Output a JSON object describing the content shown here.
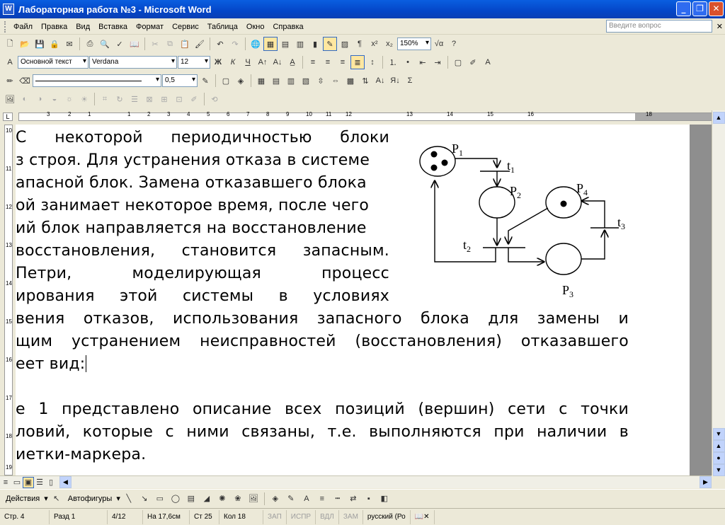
{
  "window": {
    "title": "Лабораторная работа №3 - Microsoft Word",
    "app_icon": "W"
  },
  "menu": {
    "items": [
      "Файл",
      "Правка",
      "Вид",
      "Вставка",
      "Формат",
      "Сервис",
      "Таблица",
      "Окно",
      "Справка"
    ],
    "ask_placeholder": "Введите вопрос"
  },
  "toolbar": {
    "zoom": "150%",
    "style": "Основной текст",
    "font": "Verdana",
    "size": "12",
    "line_weight": "0,5",
    "bold_label": "Ж",
    "italic_label": "К",
    "underline_label": "Ч"
  },
  "ruler": {
    "h_ticks": [
      "3",
      "2",
      "1",
      "1",
      "2",
      "3",
      "4",
      "5",
      "6",
      "7",
      "8",
      "9",
      "10",
      "11",
      "12",
      "13",
      "14",
      "15",
      "16",
      "18"
    ],
    "v_ticks": [
      "10",
      "11",
      "12",
      "13",
      "14",
      "15",
      "16",
      "17",
      "18",
      "19"
    ]
  },
  "document": {
    "lines": [
      [
        "С",
        "некоторой",
        "периодичностью",
        "блоки"
      ],
      [
        "з строя. Для устранения отказа в системе"
      ],
      [
        "апасной блок. Замена отказавшего блока"
      ],
      [
        "ой занимает некоторое время, после чего"
      ],
      [
        "ий блок направляется на восстановление"
      ],
      [
        "восстановления,",
        "становится",
        "запасным."
      ],
      [
        "Петри,",
        "моделирующая",
        "процесс"
      ],
      [
        "ирования",
        "этой",
        "системы",
        "в",
        "условиях"
      ],
      [
        "вения",
        "отказов,",
        "использования",
        "запасного",
        "блока",
        "для",
        "замены",
        "и"
      ],
      [
        "щим",
        "устранением",
        "неисправностей",
        "(восстановления)",
        "отказавшего"
      ],
      [
        "еет вид:"
      ],
      [
        ""
      ],
      [
        "е",
        "1",
        "представлено",
        "описание",
        "всех",
        "позиций",
        "(вершин)",
        "сети",
        "с",
        "точки"
      ],
      [
        "ловий,",
        "которые",
        "с",
        "ними",
        "связаны,",
        "т.е.",
        "выполняются",
        "при",
        "наличии",
        "в"
      ],
      [
        "иетки-маркера."
      ]
    ],
    "diagram_labels": {
      "p1": "P",
      "p1_sub": "1",
      "p2": "P",
      "p2_sub": "2",
      "p3": "P",
      "p3_sub": "3",
      "p4": "P",
      "p4_sub": "4",
      "t1": "t",
      "t1_sub": "1",
      "t2": "t",
      "t2_sub": "2",
      "t3": "t",
      "t3_sub": "3"
    }
  },
  "drawing": {
    "actions": "Действия",
    "autoshapes": "Автофигуры"
  },
  "status": {
    "page": "Стр. 4",
    "section": "Разд 1",
    "pages": "4/12",
    "position": "На 17,6см",
    "line": "Ст 25",
    "col": "Кол 18",
    "rec": "ЗАП",
    "trk": "ИСПР",
    "ext": "ВДЛ",
    "ovr": "ЗАМ",
    "language": "русский (Ро"
  }
}
